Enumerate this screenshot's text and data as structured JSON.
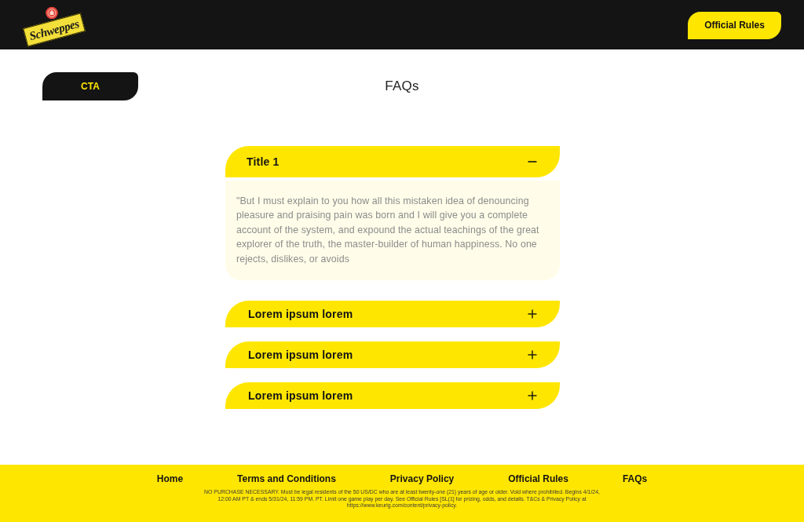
{
  "header": {
    "logo": {
      "text": "Schweppes"
    },
    "button": "Official Rules"
  },
  "cta": "CTA",
  "page_title": "FAQs",
  "faqs": [
    {
      "title": "Title 1",
      "expanded": true,
      "answer": "\"But I must explain to you how all this mistaken idea of denouncing pleasure and praising pain was born and I will give you a complete account of the system, and expound the actual teachings of the great explorer of the truth, the master-builder of human happiness. No one rejects, dislikes, or avoids"
    },
    {
      "title": "Lorem ipsum lorem",
      "expanded": false
    },
    {
      "title": "Lorem ipsum lorem",
      "expanded": false
    },
    {
      "title": "Lorem ipsum lorem",
      "expanded": false
    }
  ],
  "footer": {
    "links": [
      "Home",
      "Terms and Conditions",
      "Privacy Policy",
      "Official Rules",
      "FAQs"
    ],
    "legal": "NO PURCHASE NECESSARY. Must be legal residents of the 50 US/DC who are at least twenty-one (21) years of age or older. Void where prohibited. Begins 4/1/24, 12:00 AM PT & ends 5/31/24, 11:59 PM. PT. Limit one game play per day. See Official Rules [SL(1] for prizing, odds, and details. T&Cs & Privacy Policy at https://www.keurig.com/content/privacy-policy."
  }
}
